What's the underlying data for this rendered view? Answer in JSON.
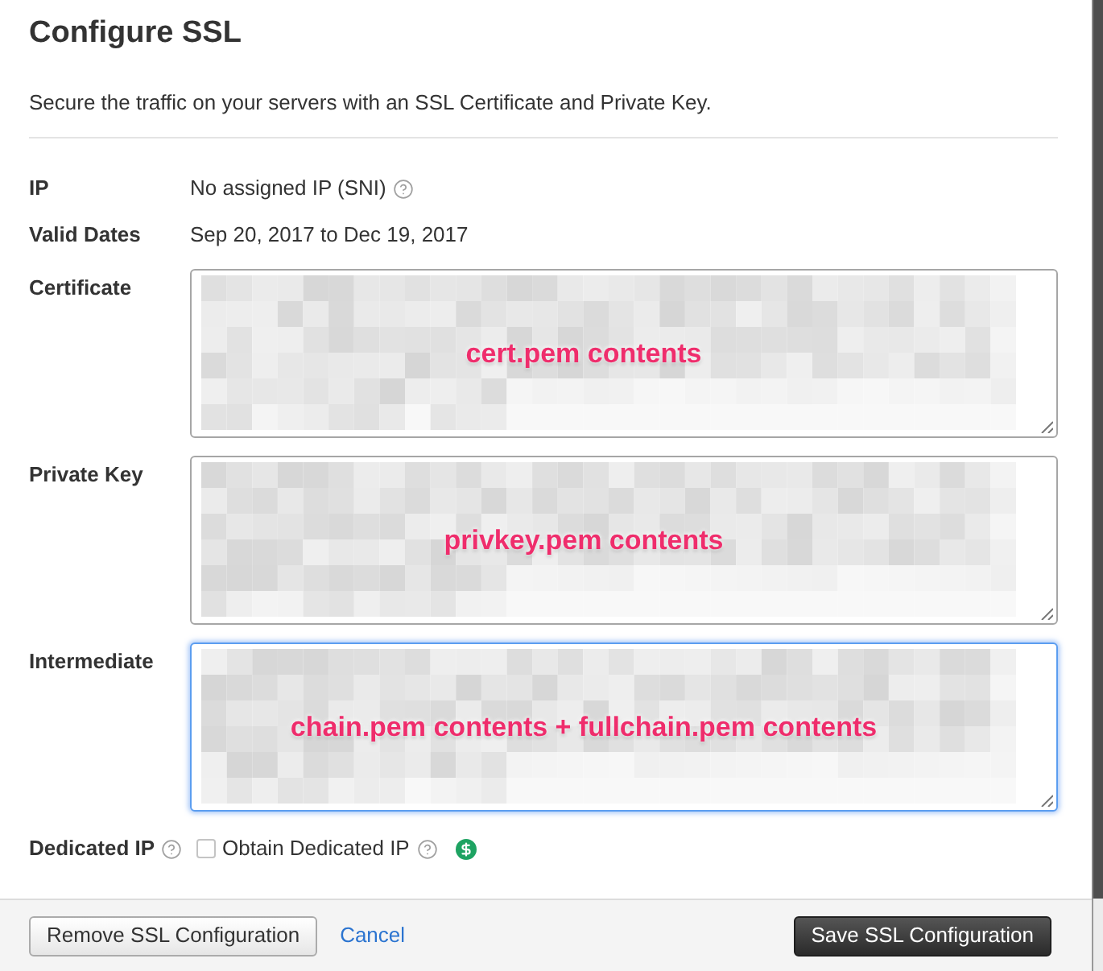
{
  "title": "Configure SSL",
  "description": "Secure the traffic on your servers with an SSL Certificate and Private Key.",
  "fields": [
    {
      "kind": "text",
      "label": "IP",
      "value": "No assigned IP (SNI)",
      "help": true
    },
    {
      "kind": "text",
      "label": "Valid Dates",
      "value": "Sep 20, 2017 to Dec 19, 2017"
    },
    {
      "kind": "textarea",
      "label": "Certificate",
      "annotation": "cert.pem contents",
      "focused": false
    },
    {
      "kind": "textarea",
      "label": "Private Key",
      "annotation": "privkey.pem contents",
      "focused": false
    },
    {
      "kind": "textarea",
      "label": "Intermediate",
      "annotation": "chain.pem contents + fullchain.pem contents",
      "focused": true
    },
    {
      "kind": "checkbox",
      "label": "Dedicated IP",
      "help": true,
      "option": "Obtain Dedicated IP",
      "checked": false,
      "option_help": true,
      "paid": true
    }
  ],
  "footer": {
    "buttons": [
      {
        "kind": "secondary",
        "label": "Remove SSL Configuration"
      },
      {
        "kind": "link",
        "label": "Cancel"
      },
      {
        "kind": "primary",
        "label": "Save SSL Configuration"
      }
    ]
  }
}
